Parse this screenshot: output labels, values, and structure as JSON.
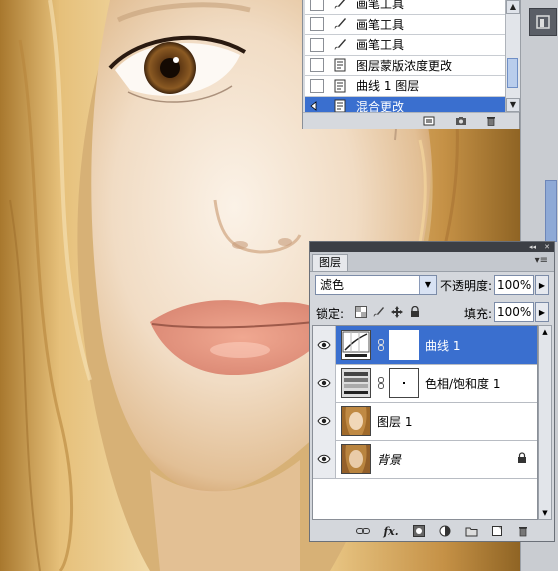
{
  "history": {
    "items": [
      {
        "label": "画笔工具",
        "icon": "brush-icon",
        "checked": false
      },
      {
        "label": "画笔工具",
        "icon": "brush-icon",
        "checked": false
      },
      {
        "label": "画笔工具",
        "icon": "brush-icon",
        "checked": false
      },
      {
        "label": "图层蒙版浓度更改",
        "icon": "history-state-icon",
        "checked": false
      },
      {
        "label": "曲线 1 图层",
        "icon": "history-state-icon",
        "checked": false
      },
      {
        "label": "混合更改",
        "icon": "history-state-icon",
        "checked": false,
        "selected": true
      }
    ],
    "footer_icons": [
      "new-document-from-state-icon",
      "camera-snapshot-icon",
      "trash-icon"
    ]
  },
  "layers_panel": {
    "tab": "图层",
    "blend_mode": "滤色",
    "opacity_label": "不透明度:",
    "opacity_value": "100%",
    "lock_label": "锁定:",
    "fill_label": "填充:",
    "fill_value": "100%",
    "layers": [
      {
        "name": "曲线 1",
        "type": "adjustment-curves",
        "visible": true,
        "selected": true
      },
      {
        "name": "色相/饱和度 1",
        "type": "adjustment-hue-saturation",
        "visible": true,
        "selected": false
      },
      {
        "name": "图层 1",
        "type": "image",
        "visible": true,
        "selected": false
      },
      {
        "name": "背景",
        "type": "background",
        "visible": true,
        "selected": false,
        "locked": true
      }
    ],
    "footer_icons": [
      "link-layers-icon",
      "fx-icon",
      "add-mask-icon",
      "new-adjustment-icon",
      "new-group-icon",
      "new-layer-icon",
      "trash-icon"
    ]
  },
  "colors": {
    "selection": "#3a6fcf",
    "panel_bg": "#d4d7dc",
    "photo_skin": "#f3e4d2",
    "photo_hair": "#d9a85b"
  }
}
